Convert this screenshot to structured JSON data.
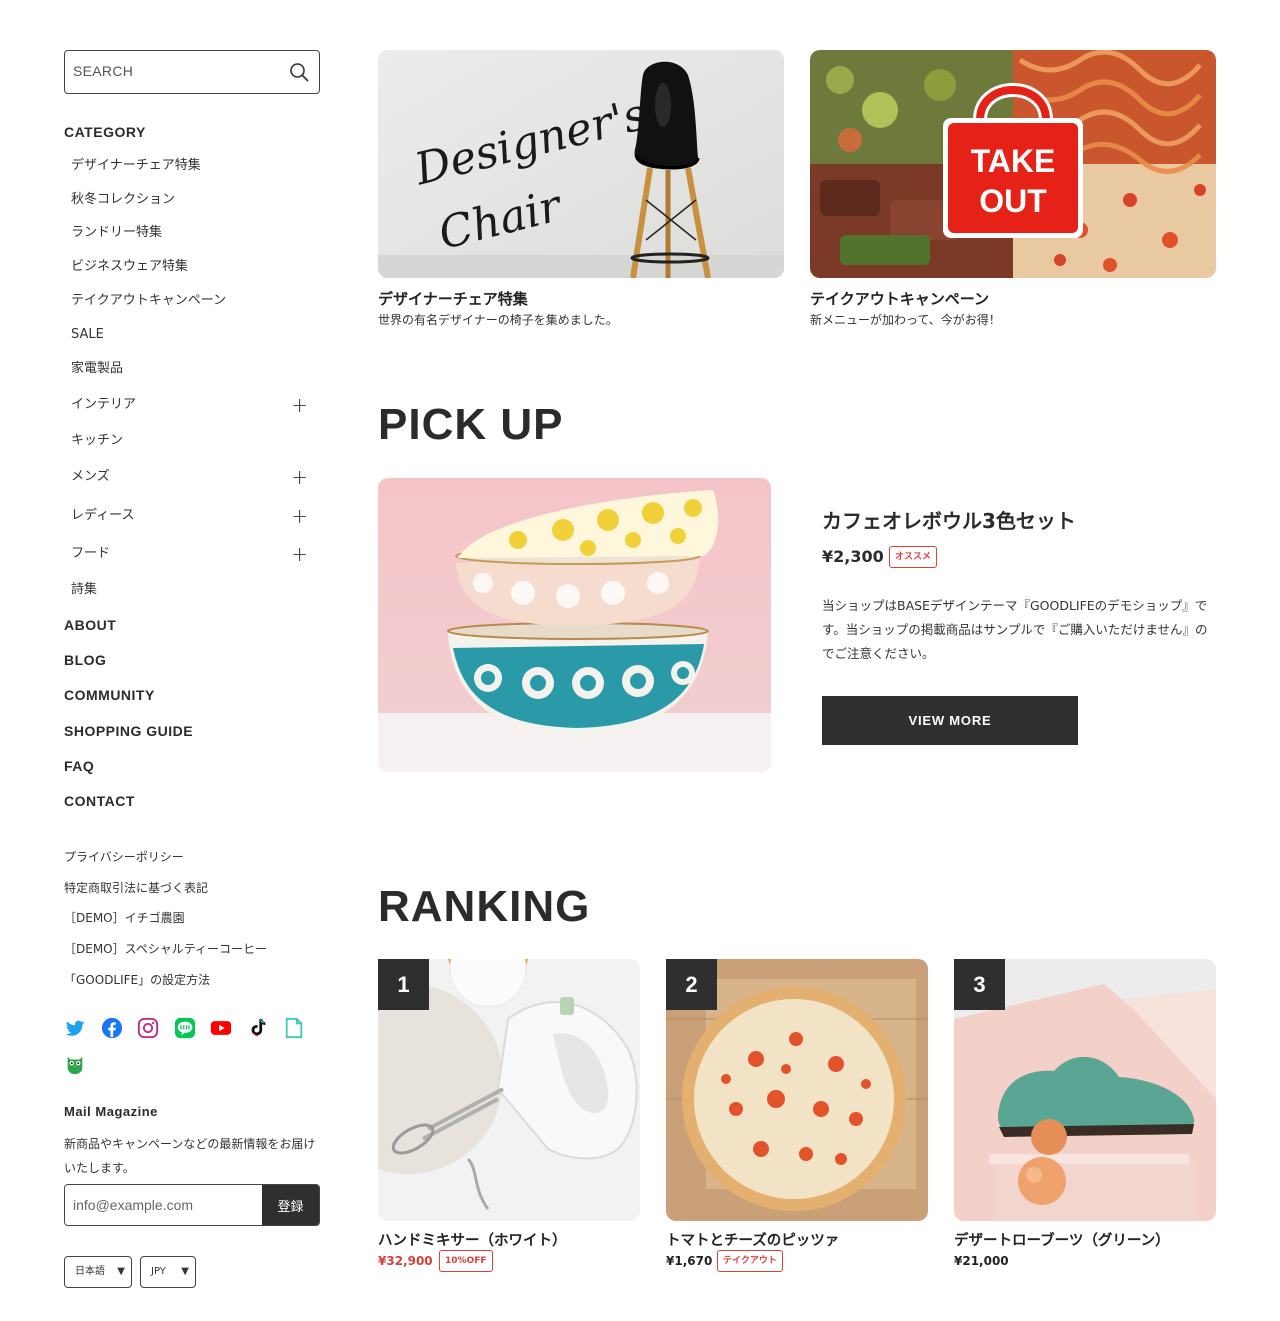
{
  "search": {
    "placeholder": "SEARCH"
  },
  "sidebar": {
    "category_title": "CATEGORY",
    "categories": [
      {
        "label": "デザイナーチェア特集",
        "expandable": false
      },
      {
        "label": "秋冬コレクション",
        "expandable": false
      },
      {
        "label": "ランドリー特集",
        "expandable": false
      },
      {
        "label": "ビジネスウェア特集",
        "expandable": false
      },
      {
        "label": "テイクアウトキャンペーン",
        "expandable": false
      },
      {
        "label": "SALE",
        "expandable": false
      },
      {
        "label": "家電製品",
        "expandable": false
      },
      {
        "label": "インテリア",
        "expandable": true
      },
      {
        "label": "キッチン",
        "expandable": false
      },
      {
        "label": "メンズ",
        "expandable": true
      },
      {
        "label": "レディース",
        "expandable": true
      },
      {
        "label": "フード",
        "expandable": true
      },
      {
        "label": "詩集",
        "expandable": false
      }
    ],
    "plus_symbol": "+",
    "nav": [
      "ABOUT",
      "BLOG",
      "COMMUNITY",
      "SHOPPING GUIDE",
      "FAQ",
      "CONTACT"
    ],
    "links": [
      "プライバシーポリシー",
      "特定商取引法に基づく表記",
      "［DEMO］イチゴ農園",
      "［DEMO］スペシャルティーコーヒー",
      "「GOODLIFE」の設定方法"
    ],
    "social": [
      "twitter-icon",
      "facebook-icon",
      "instagram-icon",
      "line-icon",
      "youtube-icon",
      "tiktok-icon",
      "note-icon",
      "owl-icon"
    ],
    "mail": {
      "title": "Mail Magazine",
      "description": "新商品やキャンペーンなどの最新情報をお届けいたします。",
      "placeholder": "info@example.com",
      "button": "登録"
    },
    "language": {
      "value": "日本語",
      "caret": "▼"
    },
    "currency": {
      "value": "JPY",
      "caret": "▼"
    }
  },
  "banners": [
    {
      "title": "デザイナーチェア特集",
      "subtitle": "世界の有名デザイナーの椅子を集めました。",
      "image_text_1": "Designer's",
      "image_text_2": "Chair"
    },
    {
      "title": "テイクアウトキャンペーン",
      "subtitle": "新メニューが加わって、今がお得！",
      "image_text_1": "TAKE",
      "image_text_2": "OUT"
    }
  ],
  "pickup": {
    "section_title": "PICK UP",
    "name": "カフェオレボウル3色セット",
    "price": "¥2,300",
    "badge": "オススメ",
    "description": "当ショップはBASEデザインテーマ『GOODLIFEのデモショップ』です。当ショップの掲載商品はサンプルで『ご購入いただけません』のでご注意ください。",
    "button": "VIEW MORE"
  },
  "ranking": {
    "section_title": "RANKING",
    "items": [
      {
        "rank": "1",
        "name": "ハンドミキサー（ホワイト）",
        "price": "¥32,900",
        "badge": "10%OFF",
        "sale": true
      },
      {
        "rank": "2",
        "name": "トマトとチーズのピッツァ",
        "price": "¥1,670",
        "badge": "テイクアウト",
        "sale": false
      },
      {
        "rank": "3",
        "name": "デザートローブーツ（グリーン）",
        "price": "¥21,000",
        "badge": "",
        "sale": false
      }
    ]
  },
  "colors": {
    "accent_red": "#d9403a",
    "dark": "#2f2f2f",
    "text": "#2b2b2b"
  }
}
